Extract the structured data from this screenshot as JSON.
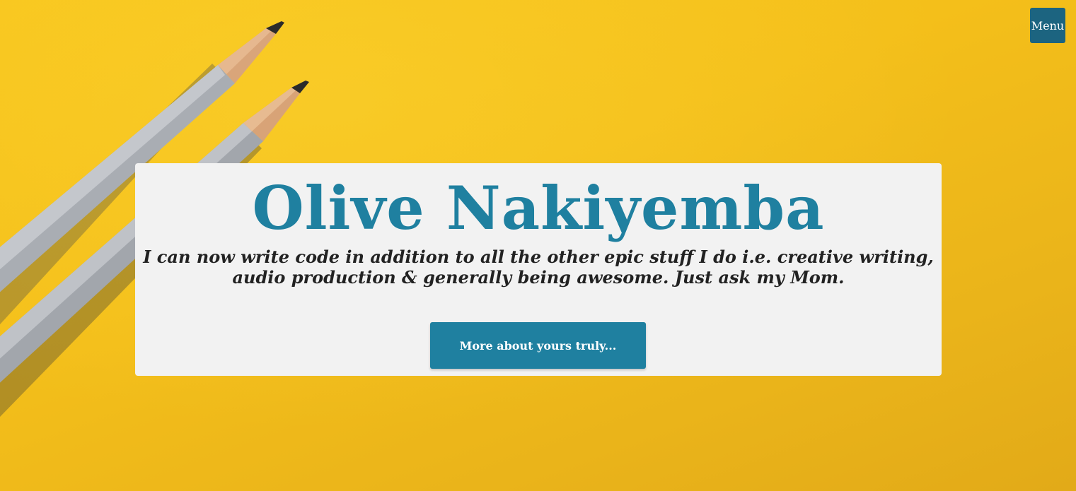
{
  "header": {
    "menu_label": "Menu"
  },
  "hero": {
    "title": "Olive Nakiyemba",
    "tagline": "I can now write code in addition to all the other epic stuff I do i.e. creative writing, audio production & generally being awesome. Just ask my Mom.",
    "cta_label": "More about yours truly..."
  },
  "theme": {
    "background": "#f4bf1a",
    "accent": "#1f80a0",
    "menu_bg": "#1c6480",
    "card_bg": "#f2f2f2",
    "text": "#222222"
  }
}
